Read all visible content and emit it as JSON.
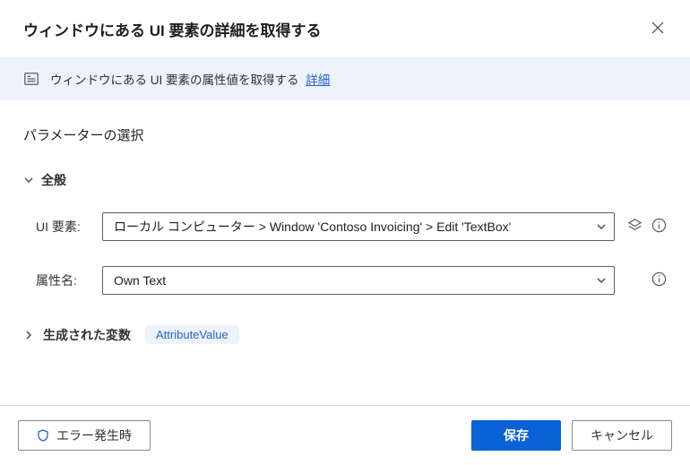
{
  "header": {
    "title": "ウィンドウにある UI 要素の詳細を取得する"
  },
  "info": {
    "text": "ウィンドウにある UI 要素の属性値を取得する",
    "link_label": "詳細"
  },
  "section_title": "パラメーターの選択",
  "group_general": {
    "label": "全般"
  },
  "fields": {
    "ui_element": {
      "label": "UI 要素:",
      "value": "ローカル コンピューター > Window 'Contoso Invoicing' > Edit 'TextBox'"
    },
    "attribute_name": {
      "label": "属性名:",
      "value": "Own Text"
    }
  },
  "variables": {
    "label": "生成された変数",
    "name": "AttributeValue"
  },
  "footer": {
    "on_error": "エラー発生時",
    "save": "保存",
    "cancel": "キャンセル"
  }
}
